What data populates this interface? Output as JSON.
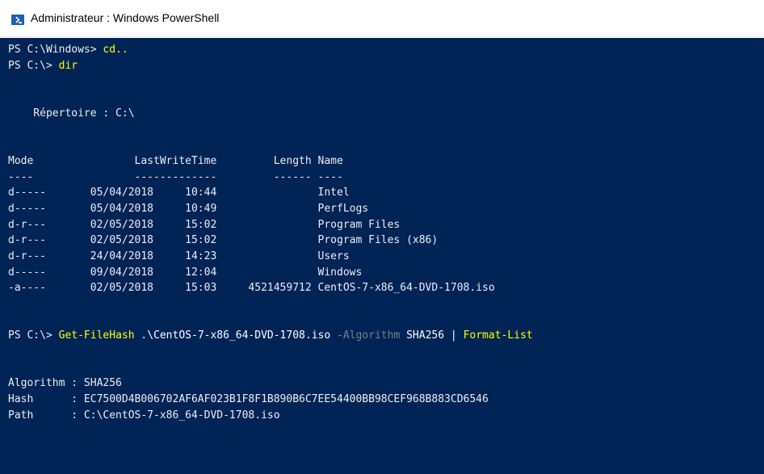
{
  "window": {
    "title": "Administrateur : Windows PowerShell",
    "icon": "powershell-icon",
    "console_bg": "#012456",
    "text_color": "#eeedf0",
    "command_color": "#ffff00",
    "parameter_color": "#7f7f7f"
  },
  "console": {
    "line1": {
      "prompt": "PS C:\\Windows> ",
      "command": "cd.."
    },
    "line2": {
      "prompt": "PS C:\\> ",
      "command": "dir"
    },
    "directory_label": "    Répertoire : C:\\",
    "header": "Mode                LastWriteTime         Length Name",
    "header_underline": "----                -------------         ------ ----",
    "rows": [
      "d-----       05/04/2018     10:44                Intel",
      "d-----       05/04/2018     10:49                PerfLogs",
      "d-r---       02/05/2018     15:02                Program Files",
      "d-r---       02/05/2018     15:02                Program Files (x86)",
      "d-r---       24/04/2018     14:23                Users",
      "d-----       09/04/2018     12:04                Windows",
      "-a----       02/05/2018     15:03     4521459712 CentOS-7-x86_64-DVD-1708.iso"
    ],
    "hash_cmd": {
      "prompt": "PS C:\\> ",
      "cmdlet": "Get-FileHash",
      "arg": " .\\CentOS-7-x86_64-DVD-1708.iso ",
      "param": "-Algorithm",
      "value": " SHA256 ",
      "pipe": "| ",
      "cmdlet2": "Format-List"
    },
    "result": {
      "algorithm": "Algorithm : SHA256",
      "hash": "Hash      : EC7500D4B006702AF6AF023B1F8F1B890B6C7EE54400BB98CEF968B883CD6546",
      "path": "Path      : C:\\CentOS-7-x86_64-DVD-1708.iso"
    }
  }
}
